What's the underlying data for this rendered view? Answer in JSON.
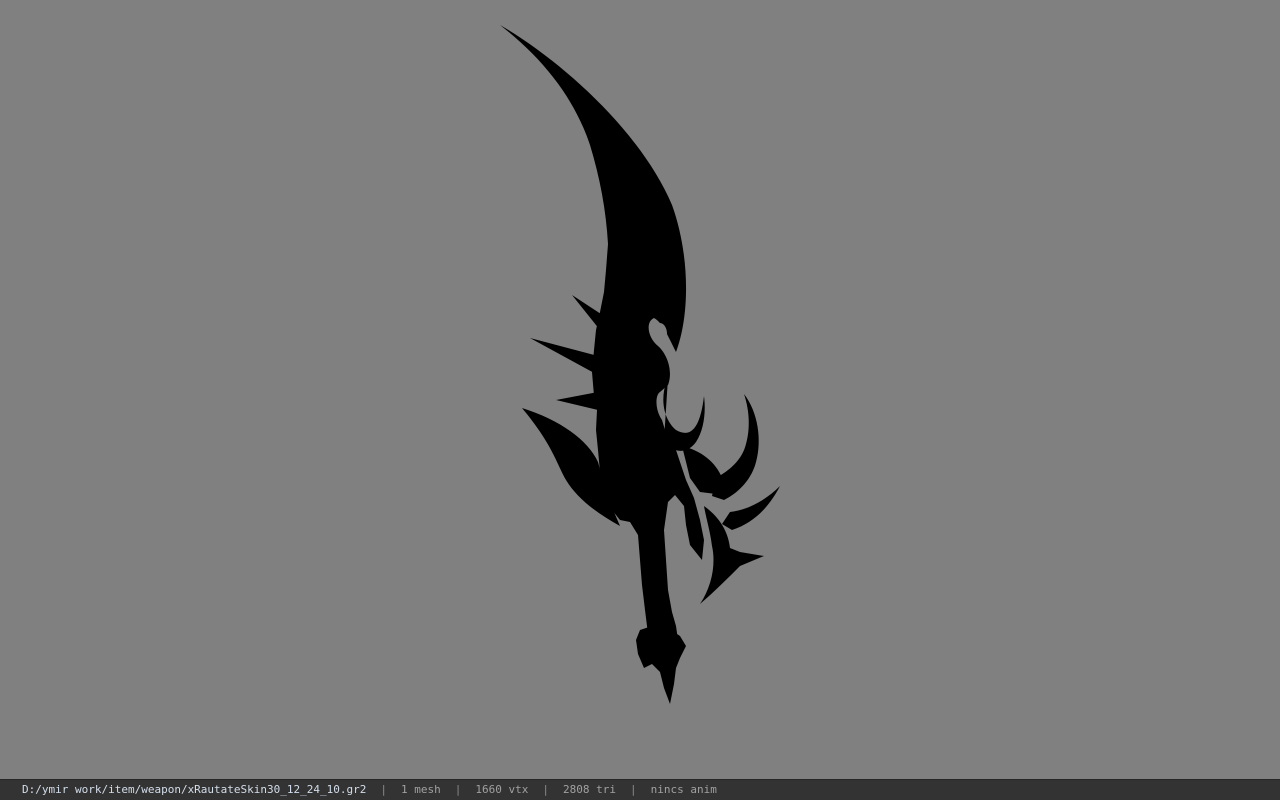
{
  "viewport": {
    "background_color": "#808080",
    "model_color": "#000000",
    "model_name": "weapon-silhouette"
  },
  "status_bar": {
    "file_path": "D:/ymir work/item/weapon/xRautateSkin30_12_24_10.gr2",
    "separator": "|",
    "mesh_count": "1 mesh",
    "vertex_count": "1660 vtx",
    "triangle_count": "2808 tri",
    "animation_status": "nincs anim",
    "path_color": "#d2ddea",
    "text_color": "#a0a0a0"
  }
}
